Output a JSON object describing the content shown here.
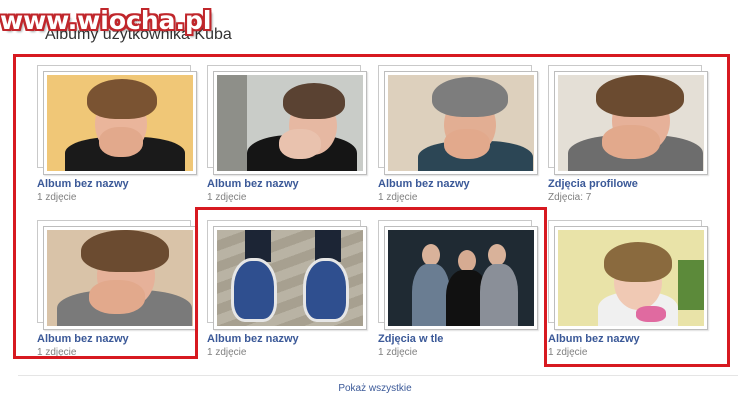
{
  "watermark": "www.wiocha.pl",
  "page_title": "Albumy użytkownika Kuba",
  "albums": [
    {
      "name": "Album bez nazwy",
      "count": "1 zdjęcie"
    },
    {
      "name": "Album bez nazwy",
      "count": "1 zdjęcie"
    },
    {
      "name": "Album bez nazwy",
      "count": "1 zdjęcie"
    },
    {
      "name": "Zdjęcia profilowe",
      "count": "Zdjęcia: 7"
    },
    {
      "name": "Album bez nazwy",
      "count": "1 zdjęcie"
    },
    {
      "name": "Album bez nazwy",
      "count": "1 zdjęcie"
    },
    {
      "name": "Zdjęcia w tle",
      "count": "1 zdjęcie"
    },
    {
      "name": "Album bez nazwy",
      "count": "1 zdjęcie"
    }
  ],
  "footer": {
    "show_all": "Pokaż wszystkie"
  },
  "colors": {
    "link": "#3b5998",
    "annotation": "#d71920"
  }
}
